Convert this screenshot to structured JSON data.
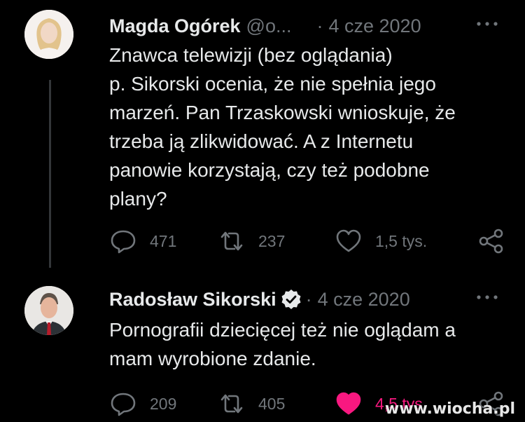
{
  "tweets": [
    {
      "author_name": "Magda Ogórek",
      "handle": "@o...",
      "separator": "·",
      "date": "4 cze 2020",
      "text": "Znawca telewizji (bez oglądania)\np. Sikorski ocenia, że nie spełnia jego\nmarzeń. Pan Trzaskowski wnioskuje, że\ntrzeba ją zlikwidować. A z Internetu\npanowie korzystają, czy też podobne\nplany?",
      "replies": "471",
      "retweets": "237",
      "likes": "1,5 tys."
    },
    {
      "author_name": "Radosław Sikorski",
      "verified": true,
      "separator": "·",
      "date": "4 cze 2020",
      "text": "Pornografii dziecięcej też nie oglądam a\nmam wyrobione zdanie.",
      "replies": "209",
      "retweets": "405",
      "likes": "4,5 tys.",
      "liked": true
    }
  ],
  "colors": {
    "background": "#000000",
    "text": "#e7e9ea",
    "secondary": "#71767b",
    "like_active": "#f91880",
    "verified": "#e7e9ea"
  },
  "icons": [
    "reply-icon",
    "retweet-icon",
    "like-icon",
    "share-icon",
    "more-icon",
    "verified-icon"
  ],
  "watermark": "www.wiocha.pl"
}
